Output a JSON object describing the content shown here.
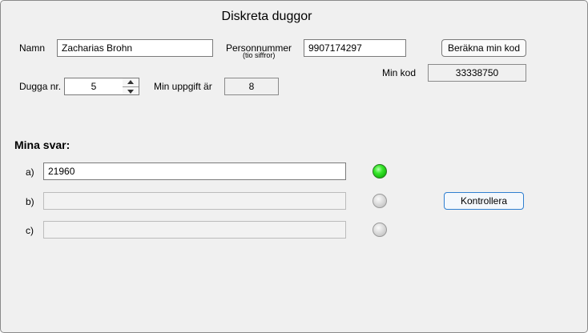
{
  "window": {
    "title": "Diskreta duggor"
  },
  "form": {
    "name_label": "Namn",
    "name_value": "Zacharias Brohn",
    "pnr_label": "Personnummer",
    "pnr_sublabel": "(tio siffror)",
    "pnr_value": "9907174297",
    "calc_button": "Beräkna min kod",
    "code_label": "Min kod",
    "code_value": "33338750",
    "dugga_label": "Dugga nr.",
    "dugga_value": "5",
    "task_label": "Min uppgift är",
    "task_value": "8"
  },
  "answers": {
    "heading": "Mina svar:",
    "items": [
      {
        "label": "a)",
        "value": "21960",
        "status": "correct"
      },
      {
        "label": "b)",
        "value": "",
        "status": "none"
      },
      {
        "label": "c)",
        "value": "",
        "status": "none"
      }
    ],
    "check_button": "Kontrollera"
  },
  "colors": {
    "led_on": "#22cc18",
    "led_off": "#c8c8c8",
    "focus_border": "#2f7fd0"
  }
}
